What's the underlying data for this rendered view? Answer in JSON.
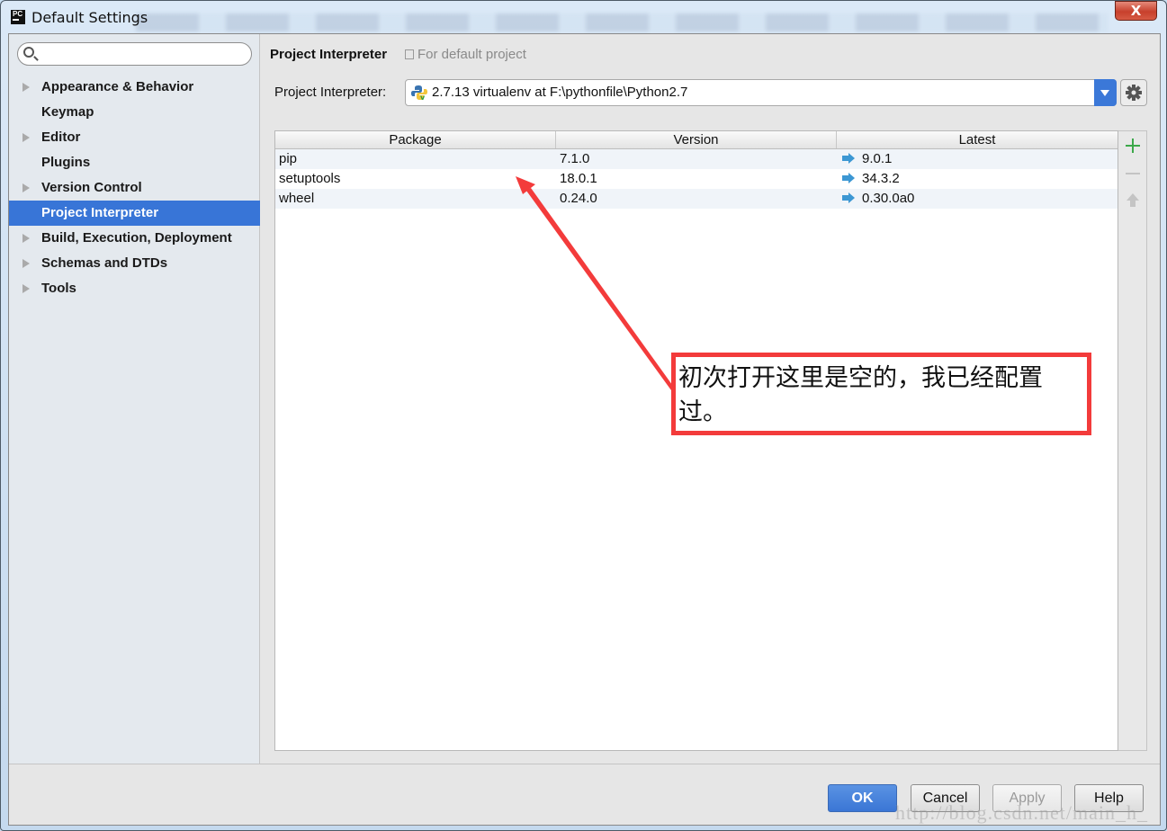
{
  "window": {
    "title": "Default Settings",
    "app_icon": "PC",
    "close_label": "X"
  },
  "sidebar": {
    "search_placeholder": "",
    "search_value": "",
    "items": [
      {
        "label": "Appearance & Behavior",
        "expandable": true,
        "selected": false
      },
      {
        "label": "Keymap",
        "expandable": false,
        "selected": false
      },
      {
        "label": "Editor",
        "expandable": true,
        "selected": false
      },
      {
        "label": "Plugins",
        "expandable": false,
        "selected": false
      },
      {
        "label": "Version Control",
        "expandable": true,
        "selected": false
      },
      {
        "label": "Project Interpreter",
        "expandable": false,
        "selected": true
      },
      {
        "label": "Build, Execution, Deployment",
        "expandable": true,
        "selected": false
      },
      {
        "label": "Schemas and DTDs",
        "expandable": true,
        "selected": false
      },
      {
        "label": "Tools",
        "expandable": true,
        "selected": false
      }
    ]
  },
  "header": {
    "title": "Project Interpreter",
    "subtitle": "For default project"
  },
  "interpreter": {
    "label": "Project Interpreter:",
    "selected": "2.7.13 virtualenv at F:\\pythonfile\\Python2.7"
  },
  "packages": {
    "columns": [
      "Package",
      "Version",
      "Latest"
    ],
    "rows": [
      {
        "package": "pip",
        "version": "7.1.0",
        "latest": "9.0.1",
        "upgrade_available": true
      },
      {
        "package": "setuptools",
        "version": "18.0.1",
        "latest": "34.3.2",
        "upgrade_available": true
      },
      {
        "package": "wheel",
        "version": "0.24.0",
        "latest": "0.30.0a0",
        "upgrade_available": true
      }
    ]
  },
  "side_tools": [
    "plus-icon",
    "minus-icon",
    "upgrade-arrow-icon"
  ],
  "footer": {
    "ok": "OK",
    "cancel": "Cancel",
    "apply": "Apply",
    "help": "Help"
  },
  "watermark": "http://blog.csdn.net/main_h_",
  "annotation": {
    "text": "初次打开这里是空的，我已经配置过。",
    "color": "#f33b3b"
  },
  "colors": {
    "accent": "#3875d7",
    "upgrade_arrow": "#3c97d3",
    "add_icon": "#3ca84a"
  }
}
